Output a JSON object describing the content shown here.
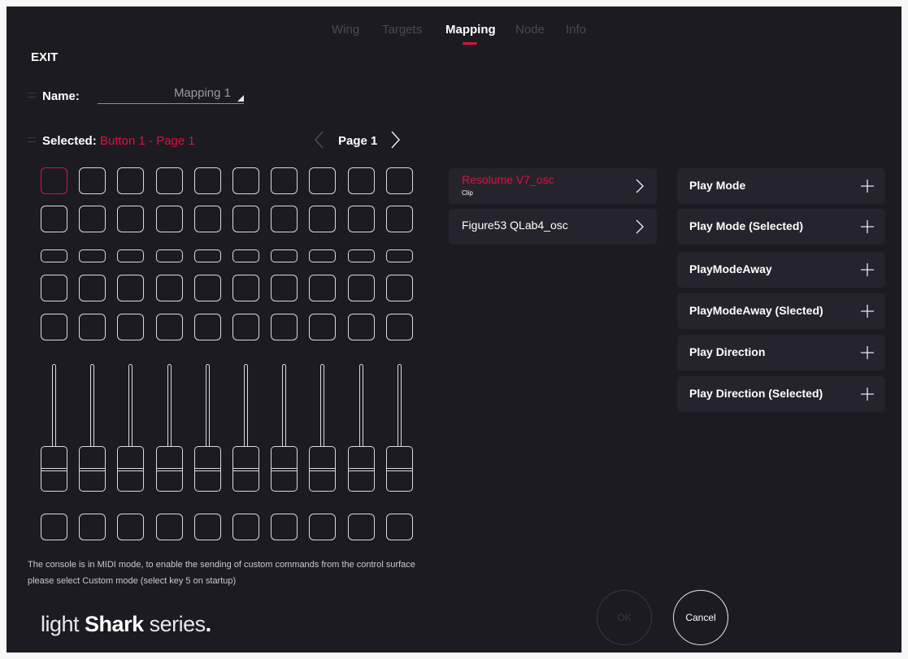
{
  "tabs": [
    {
      "label": "Wing",
      "active": false
    },
    {
      "label": "Targets",
      "active": false
    },
    {
      "label": "Mapping",
      "active": true
    },
    {
      "label": "Node",
      "active": false
    },
    {
      "label": "Info",
      "active": false
    }
  ],
  "exit_label": "EXIT",
  "name": {
    "label": "Name:",
    "value": "Mapping 1"
  },
  "selected": {
    "label": "Selected:",
    "value": "Button 1 - Page 1"
  },
  "page": {
    "label": "Page 1"
  },
  "controller": {
    "columns": 10,
    "rows": [
      "pad",
      "pad",
      "small",
      "pad",
      "pad"
    ],
    "selected_pad": "row 1, column 1",
    "faders": 10,
    "bottom_pads": 10
  },
  "info_text": "The console is in MIDI mode, to enable the sending of custom commands from the control surface please select Custom mode (select key 5 on startup)",
  "brand": {
    "light": "light ",
    "shark": "Shark",
    "series": " series",
    "dot": "."
  },
  "targets": [
    {
      "name": "Resolume V7_osc",
      "sub": "Clip",
      "active": true
    },
    {
      "name": "Figure53 QLab4_osc",
      "sub": "",
      "active": false
    }
  ],
  "actions": [
    {
      "label": "Play Mode"
    },
    {
      "label": "Play Mode (Selected)"
    },
    {
      "label": "PlayModeAway"
    },
    {
      "label": "PlayModeAway (Slected)"
    },
    {
      "label": "Play Direction"
    },
    {
      "label": "Play Direction (Selected)"
    }
  ],
  "buttons": {
    "ok": "OK",
    "cancel": "Cancel"
  },
  "colors": {
    "accent": "#e0103f",
    "background": "#1c1b21",
    "panel": "#25242c"
  }
}
